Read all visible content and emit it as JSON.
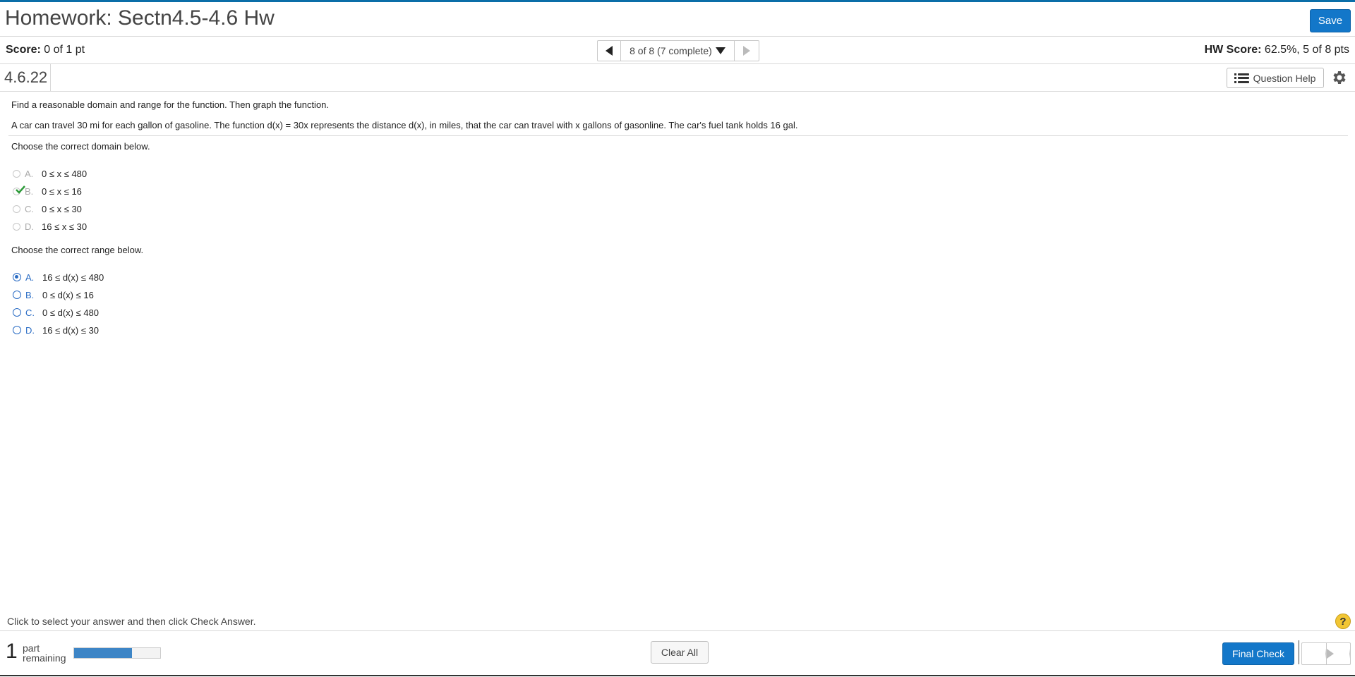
{
  "header": {
    "title": "Homework: Sectn4.5-4.6 Hw",
    "save_label": "Save"
  },
  "scorebar": {
    "score_label": "Score:",
    "score_value": "0 of 1 pt",
    "nav_text": "8 of 8 (7 complete)",
    "hw_score_label": "HW Score:",
    "hw_score_value": "62.5%, 5 of 8 pts"
  },
  "question": {
    "number": "4.6.22",
    "help_label": "Question Help",
    "instruction": "Find a reasonable domain and range for the function. Then graph the function.",
    "problem": "A car can travel 30 mi for each gallon of gasoline. The function d(x) = 30x represents the distance d(x), in miles, that the car can travel with x gallons of gasonline. The car's fuel tank holds 16 gal.",
    "domain_prompt": "Choose the correct domain below.",
    "domain_options": [
      {
        "letter": "A.",
        "text": "0 ≤ x ≤ 480"
      },
      {
        "letter": "B.",
        "text": "0 ≤ x ≤ 16",
        "correct": true
      },
      {
        "letter": "C.",
        "text": "0 ≤ x ≤ 30"
      },
      {
        "letter": "D.",
        "text": "16 ≤ x ≤ 30"
      }
    ],
    "range_prompt": "Choose the correct range below.",
    "range_options": [
      {
        "letter": "A.",
        "text": "16 ≤ d(x) ≤ 480",
        "selected": true
      },
      {
        "letter": "B.",
        "text": "0 ≤ d(x) ≤ 16"
      },
      {
        "letter": "C.",
        "text": "0 ≤ d(x) ≤ 480"
      },
      {
        "letter": "D.",
        "text": "16 ≤ d(x) ≤ 30"
      }
    ]
  },
  "footer": {
    "hint": "Click to select your answer and then click Check Answer.",
    "help_symbol": "?",
    "parts_count": "1",
    "parts_word1": "part",
    "parts_word2": "remaining",
    "progress_fraction": 0.67,
    "clear_all_label": "Clear All",
    "final_check_label": "Final Check"
  },
  "colors": {
    "accent": "#1377c9",
    "top_line": "#0a6ea8",
    "check_green": "#2e9b3a"
  }
}
